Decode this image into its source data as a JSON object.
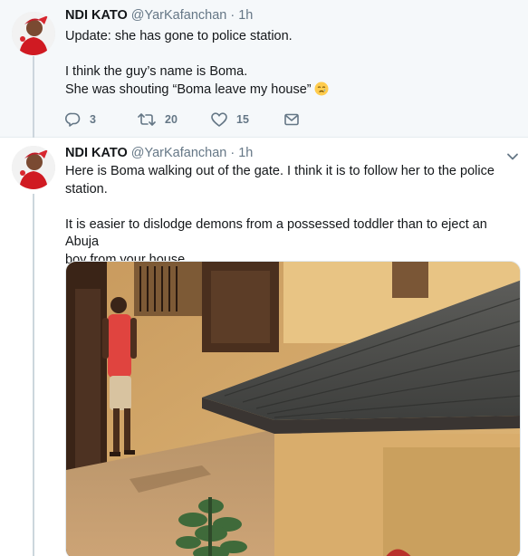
{
  "tweets": [
    {
      "name": "NDI KATO",
      "handle": "@YarKafanchan",
      "separator": "·",
      "time": "1h",
      "lines": [
        "Update: she has gone to police station.",
        "",
        "I think the guy’s name is Boma.",
        "She was shouting “Boma leave my house”"
      ],
      "emoji": "crying-face",
      "actions": {
        "reply_count": "3",
        "retweet_count": "20",
        "like_count": "15"
      }
    },
    {
      "name": "NDI KATO",
      "handle": "@YarKafanchan",
      "separator": "·",
      "time": "1h",
      "lines": [
        "Here is Boma walking out of the gate. I think it is to follow her to the police",
        "station.",
        "",
        "It is easier to dislodge demons from a possessed toddler than to eject an Abuja",
        "boy from your house."
      ],
      "media": "photo-man-walking-near-roof"
    }
  ],
  "colors": {
    "accent": "#1da1f2",
    "muted": "#657786",
    "thread_line": "#ccd6dd",
    "highlight_bg": "#f5f8fa"
  },
  "icons": [
    "reply-icon",
    "retweet-icon",
    "like-icon",
    "direct-message-icon",
    "caret-down-icon"
  ]
}
